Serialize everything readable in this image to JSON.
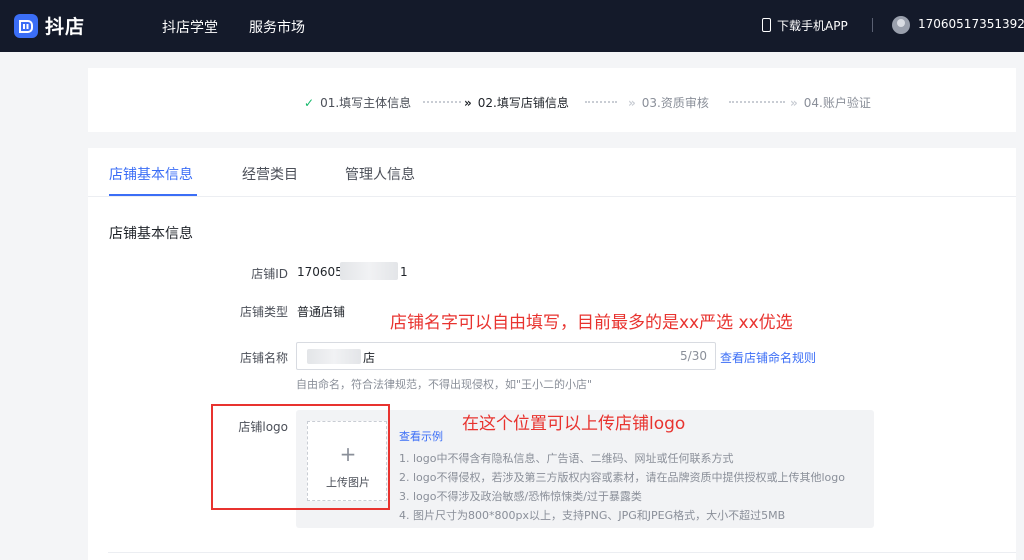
{
  "header": {
    "logo_text": "抖店",
    "nav": [
      "抖店学堂",
      "服务市场"
    ],
    "download_app": "下载手机APP",
    "account": "17060517351392"
  },
  "steps": [
    {
      "label": "01.填写主体信息",
      "state": "done"
    },
    {
      "label": "02.填写店铺信息",
      "state": "current"
    },
    {
      "label": "03.资质审核",
      "state": "pending"
    },
    {
      "label": "04.账户验证",
      "state": "pending"
    }
  ],
  "tabs": [
    "店铺基本信息",
    "经营类目",
    "管理人信息"
  ],
  "section_title": "店铺基本信息",
  "form": {
    "shop_id_label": "店铺ID",
    "shop_id_prefix": "170605",
    "shop_id_suffix": "1",
    "shop_type_label": "店铺类型",
    "shop_type_value": "普通店铺",
    "shop_name_label": "店铺名称",
    "shop_name_value_visible": "店",
    "shop_name_count": "5/30",
    "shop_name_rule_link": "查看店铺命名规则",
    "shop_name_hint": "自由命名，符合法律规范，不得出现侵权，如\"王小二的小店\"",
    "logo_label": "店铺logo",
    "upload_plus": "+",
    "upload_label": "上传图片",
    "example_link": "查看示例",
    "logo_rules": [
      "1. logo中不得含有隐私信息、广告语、二维码、网址或任何联系方式",
      "2. logo不得侵权，若涉及第三方版权内容或素材，请在品牌资质中提供授权或上传其他logo",
      "3. logo不得涉及政治敏感/恐怖惊悚类/过于暴露类",
      "4. 图片尺寸为800*800px以上，支持PNG、JPG和JPEG格式，大小不超过5MB"
    ]
  },
  "annotations": {
    "name_note": "店铺名字可以自由填写，目前最多的是xx严选  xx优选",
    "logo_note": "在这个位置可以上传店铺logo",
    "color": "#e8332f"
  },
  "colors": {
    "topbar": "#141a2a",
    "accent": "#3b6ef6",
    "done_check": "#14b86a"
  }
}
